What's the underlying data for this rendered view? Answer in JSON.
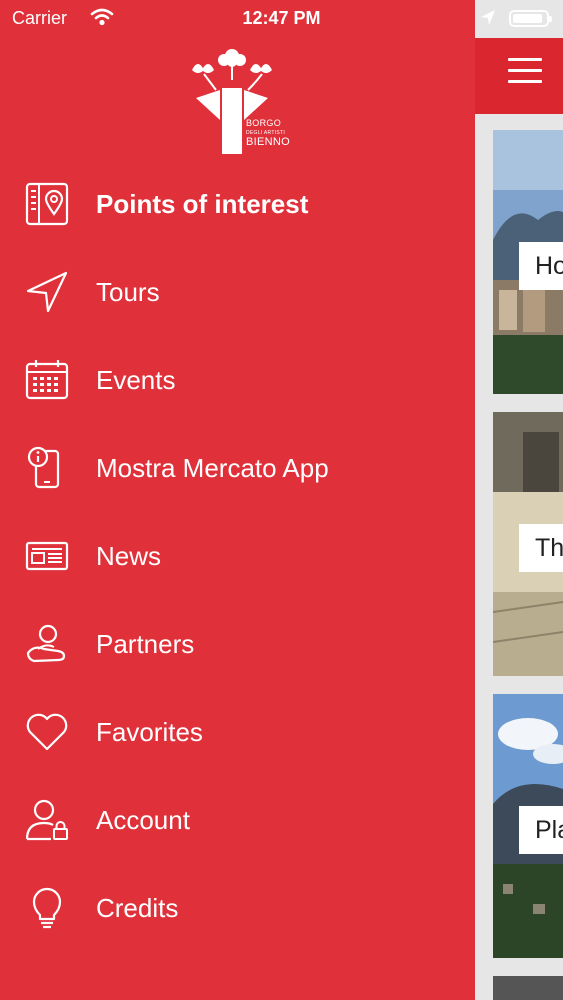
{
  "status_bar": {
    "carrier": "Carrier",
    "time": "12:47 PM",
    "battery_level": 0.9
  },
  "brand": {
    "line1": "BORGO",
    "line2": "DEGLI ARTISTI",
    "line3": "BIENNO",
    "color": "#e0313b"
  },
  "menu": {
    "items": [
      {
        "label": "Points of interest",
        "icon": "map-pin-book-icon",
        "active": true
      },
      {
        "label": "Tours",
        "icon": "navigation-arrow-icon"
      },
      {
        "label": "Events",
        "icon": "calendar-icon"
      },
      {
        "label": "Mostra Mercato App",
        "icon": "phone-info-icon"
      },
      {
        "label": "News",
        "icon": "newspaper-icon"
      },
      {
        "label": "Partners",
        "icon": "handshake-icon"
      },
      {
        "label": "Favorites",
        "icon": "heart-icon"
      },
      {
        "label": "Account",
        "icon": "user-lock-icon"
      },
      {
        "label": "Credits",
        "icon": "lightbulb-icon"
      }
    ]
  },
  "content": {
    "cards": [
      {
        "label": "Ho"
      },
      {
        "label": "Th"
      },
      {
        "label": "Pla"
      }
    ]
  }
}
